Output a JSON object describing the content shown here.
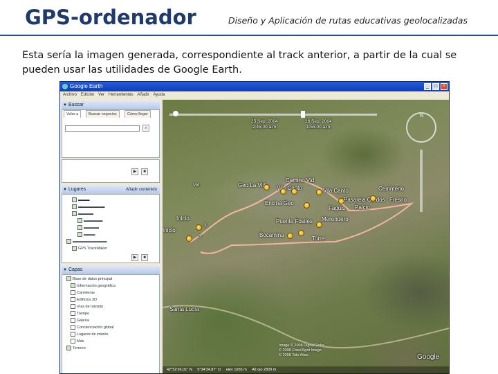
{
  "slide": {
    "title": "GPS-ordenador",
    "subtitle": "Diseño y Aplicación de rutas educativas geolocalizadas",
    "body": "Esta sería la imagen generada, correspondiente al track anterior, a partir de la cual se pueden usar las utilidades de Google Earth."
  },
  "window": {
    "title": "Google Earth",
    "menu": [
      "Archivo",
      "Edición",
      "Ver",
      "Herramientas",
      "Añadir",
      "Ayuda"
    ],
    "buttons": {
      "minimize": "_",
      "maximize": "□",
      "close": "×"
    }
  },
  "sidebar": {
    "search_header": "Buscar",
    "search_tabs": [
      "Volar a",
      "Buscar negocios",
      "Cómo llegar"
    ],
    "places_header": "Lugares",
    "places_action": "Añadir contenido",
    "places_items": [
      "GPS TrackMaker"
    ],
    "layers_header": "Capas",
    "layers_items": [
      "Base de datos principal",
      "Información geográfica",
      "Carreteras",
      "Edificios 3D",
      "Vías de tránsito",
      "Tiempo",
      "Galería",
      "Concienciación global",
      "Lugares de interés",
      "Más"
    ],
    "terrain_label": "Terreno"
  },
  "map": {
    "date_start": "25 Sep. 2004",
    "time_start": "2:45:00 a.m.",
    "date_end": "26 Sep. 2004",
    "time_end": "1:55:00 a.m.",
    "labels": [
      "Geo La Vid",
      "Camino Vid",
      "Vila Canto",
      "Vila Canto",
      "Cemnterio",
      "Pasarela Cardos",
      "Fresno",
      "Encina Geo",
      "Faguis",
      "Palcio",
      "Merendero",
      "Puente Fosiles",
      "Bocamina",
      "Torre",
      "Inicio",
      "Inicio",
      "Santa Lucía",
      "Vid",
      "3",
      "3"
    ],
    "attribution": [
      "Image © 2008 DigitalGlobe",
      "© 2008 Cnes/Spot Image",
      "© 2008 Tele Atlas"
    ],
    "google_logo": "Google",
    "status": [
      "42°52'26.01\" N",
      "5°34'34.87\" O",
      "elev 1055 m",
      "Alt ojo 2809 m"
    ]
  }
}
